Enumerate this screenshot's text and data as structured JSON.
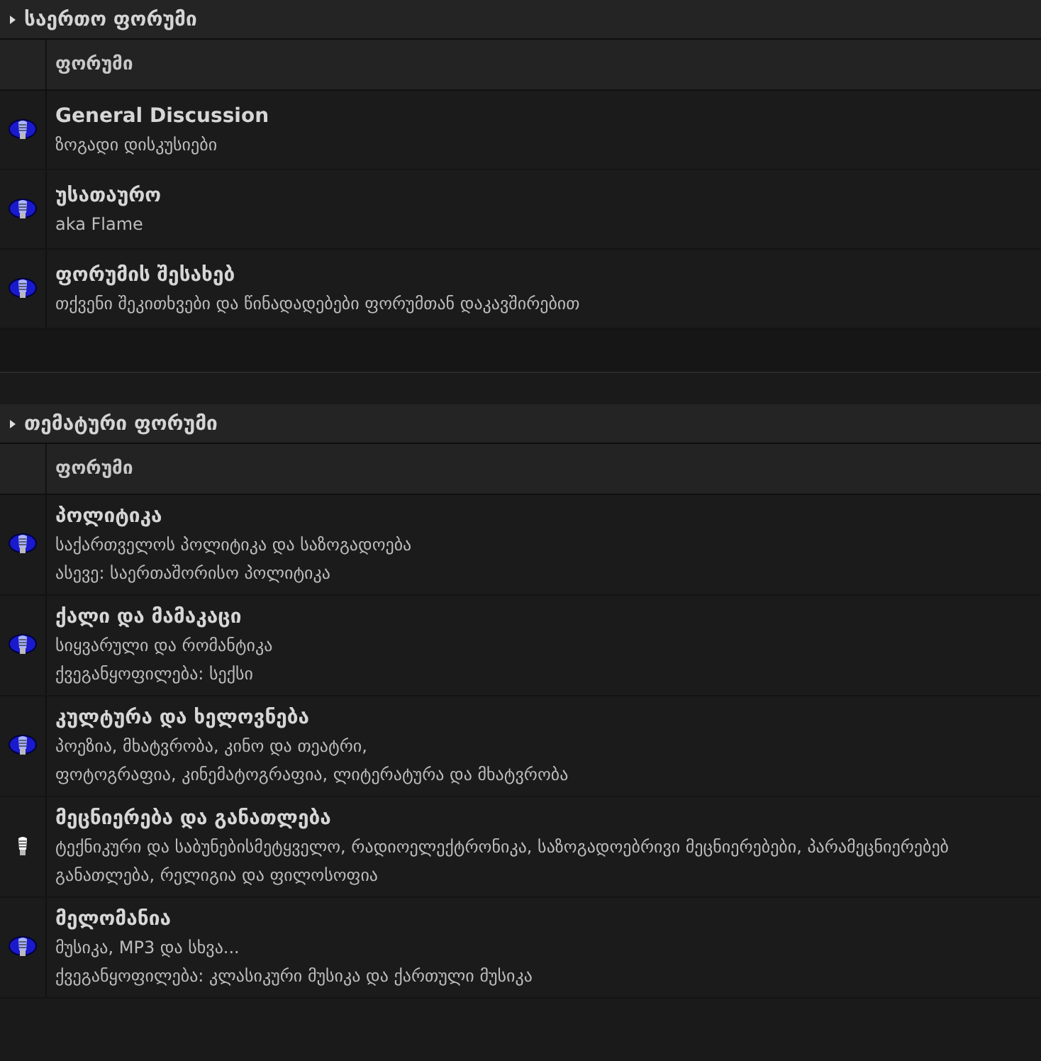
{
  "sections": [
    {
      "title": "საერთო ფორუმი",
      "column_header": "ფორუმი",
      "forums": [
        {
          "name": "General Discussion",
          "new_posts": true,
          "description": [
            "ზოგადი დისკუსიები"
          ]
        },
        {
          "name": "უსათაურო",
          "new_posts": true,
          "description": [
            "aka Flame"
          ]
        },
        {
          "name": "ფორუმის შესახებ",
          "new_posts": true,
          "description": [
            "თქვენი შეკითხვები და წინადადებები ფორუმთან დაკავშირებით"
          ]
        }
      ]
    },
    {
      "title": "თემატური ფორუმი",
      "column_header": "ფორუმი",
      "forums": [
        {
          "name": "პოლიტიკა",
          "new_posts": true,
          "description": [
            "საქართველოს პოლიტიკა და საზოგადოება",
            "ასევე: საერთაშორისო პოლიტიკა"
          ]
        },
        {
          "name": "ქალი და მამაკაცი",
          "new_posts": true,
          "description": [
            "სიყვარული და რომანტიკა",
            "ქვეგანყოფილება: სექსი"
          ]
        },
        {
          "name": "კულტურა და ხელოვნება",
          "new_posts": true,
          "description": [
            "პოეზია, მხატვრობა, კინო და თეატრი,",
            "ფოტოგრაფია, კინემატოგრაფია, ლიტერატურა და მხატვრობა"
          ]
        },
        {
          "name": "მეცნიერება და განათლება",
          "new_posts": false,
          "description": [
            "ტექნიკური და საბუნებისმეტყველო, რადიოელექტრონიკა, საზოგადოებრივი მეცნიერებები, პარამეცნიერებებ",
            "განათლება, რელიგია და ფილოსოფია"
          ]
        },
        {
          "name": "მელომანია",
          "new_posts": true,
          "description": [
            "მუსიკა, MP3 და სხვა...",
            "ქვეგანყოფილება: კლასიკური მუსიკა და ქართული მუსიკა"
          ]
        }
      ]
    }
  ]
}
